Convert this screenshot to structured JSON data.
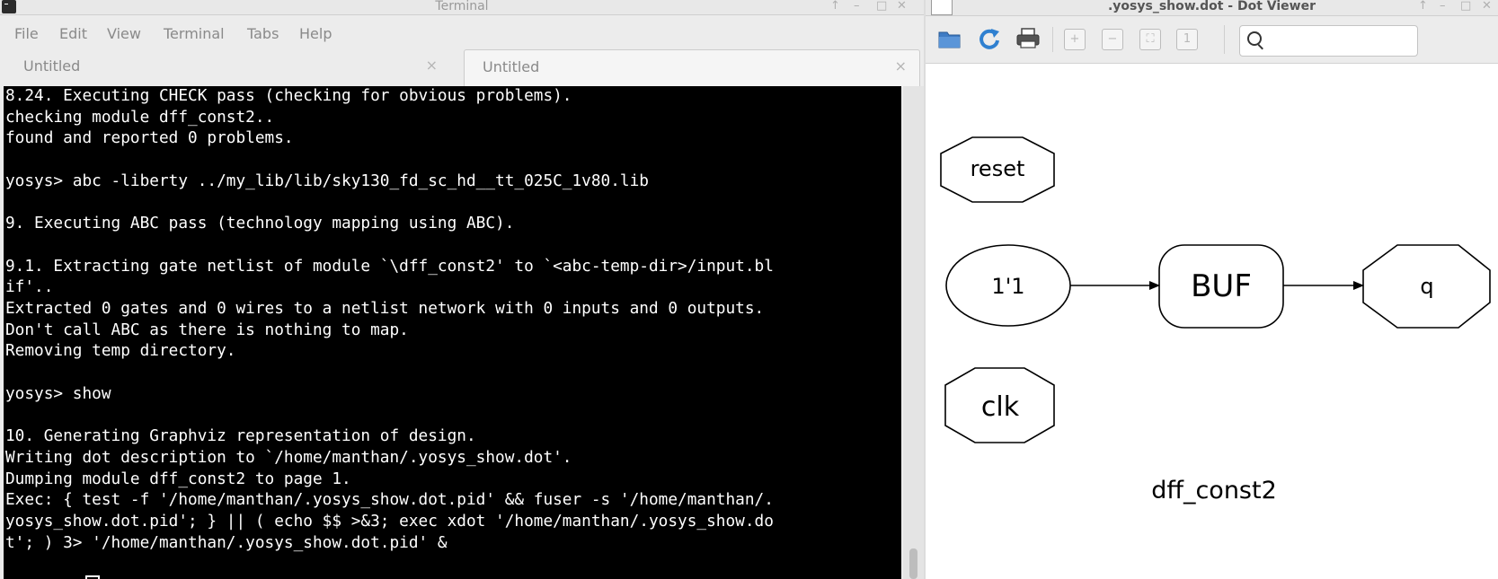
{
  "terminal": {
    "title": "Terminal",
    "menu": [
      "File",
      "Edit",
      "View",
      "Terminal",
      "Tabs",
      "Help"
    ],
    "tabs": [
      {
        "label": "Untitled",
        "close": "×"
      },
      {
        "label": "Untitled",
        "close": "×"
      }
    ],
    "output": "8.24. Executing CHECK pass (checking for obvious problems).\nchecking module dff_const2..\nfound and reported 0 problems.\n\nyosys> abc -liberty ../my_lib/lib/sky130_fd_sc_hd__tt_025C_1v80.lib\n\n9. Executing ABC pass (technology mapping using ABC).\n\n9.1. Extracting gate netlist of module `\\dff_const2' to `<abc-temp-dir>/input.bl\nif'..\nExtracted 0 gates and 0 wires to a netlist network with 0 inputs and 0 outputs.\nDon't call ABC as there is nothing to map.\nRemoving temp directory.\n\nyosys> show\n\n10. Generating Graphviz representation of design.\nWriting dot description to `/home/manthan/.yosys_show.dot'.\nDumping module dff_const2 to page 1.\nExec: { test -f '/home/manthan/.yosys_show.dot.pid' && fuser -s '/home/manthan/.\nyosys_show.dot.pid'; } || ( echo $$ >&3; exec xdot '/home/manthan/.yosys_show.do\nt'; ) 3> '/home/manthan/.yosys_show.dot.pid' &"
  },
  "dotviewer": {
    "title": ".yosys_show.dot - Dot Viewer",
    "toolbar": [
      "open-icon",
      "reload-icon",
      "print-icon",
      "zoom-in-icon",
      "zoom-out-icon",
      "zoom-fit-icon",
      "zoom-100-icon"
    ],
    "search": {
      "value": "",
      "placeholder": ""
    },
    "graph": {
      "nodes": {
        "reset": "reset",
        "const": "1'1",
        "buf": "BUF",
        "q": "q",
        "clk": "clk"
      },
      "label": "dff_const2"
    }
  },
  "colors": {
    "terminal_bg": "#000000",
    "terminal_fg": "#ffffff",
    "reload_blue": "#2f80d0"
  }
}
